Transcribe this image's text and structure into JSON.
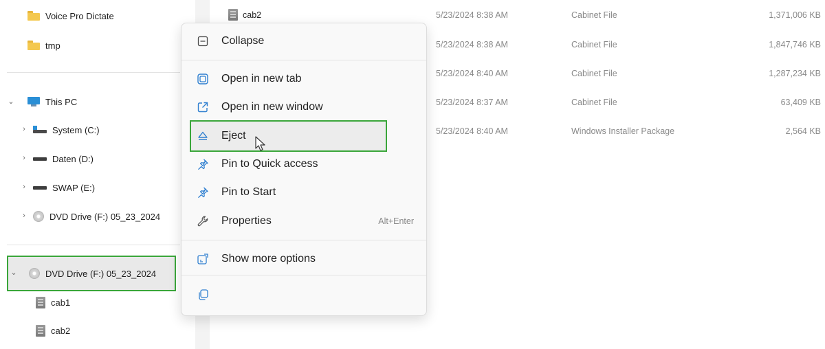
{
  "nav": {
    "items": [
      {
        "label": "Voice Pro Dictate",
        "icon": "folder-icon"
      },
      {
        "label": "tmp",
        "icon": "folder-icon"
      },
      {
        "label": "This PC",
        "icon": "computer-icon",
        "chevron": "expanded"
      },
      {
        "label": "System (C:)",
        "icon": "system-drive-icon",
        "chevron": "collapsed"
      },
      {
        "label": "Daten (D:)",
        "icon": "hard-drive-icon",
        "chevron": "collapsed"
      },
      {
        "label": "SWAP (E:)",
        "icon": "hard-drive-icon",
        "chevron": "collapsed"
      },
      {
        "label": "DVD Drive (F:) 05_23_2024",
        "icon": "dvd-drive-icon",
        "chevron": "collapsed"
      },
      {
        "label": "DVD Drive (F:) 05_23_2024",
        "icon": "dvd-drive-icon",
        "chevron": "expanded",
        "selected": true
      },
      {
        "label": "cab1",
        "icon": "cabinet-file-icon"
      },
      {
        "label": "cab2",
        "icon": "cabinet-file-icon"
      }
    ]
  },
  "files": [
    {
      "name": "cab2",
      "date": "5/23/2024 8:38 AM",
      "type": "Cabinet File",
      "size": "1,371,006 KB"
    },
    {
      "name": "",
      "date": "5/23/2024 8:38 AM",
      "type": "Cabinet File",
      "size": "1,847,746 KB"
    },
    {
      "name": "",
      "date": "5/23/2024 8:40 AM",
      "type": "Cabinet File",
      "size": "1,287,234 KB"
    },
    {
      "name": "",
      "date": "5/23/2024 8:37 AM",
      "type": "Cabinet File",
      "size": "63,409 KB"
    },
    {
      "name": "",
      "date": "5/23/2024 8:40 AM",
      "type": "Windows Installer Package",
      "size": "2,564 KB"
    }
  ],
  "menu": {
    "collapse": "Collapse",
    "open_new_tab": "Open in new tab",
    "open_new_window": "Open in new window",
    "eject": "Eject",
    "pin_quick_access": "Pin to Quick access",
    "pin_start": "Pin to Start",
    "properties": "Properties",
    "properties_shortcut": "Alt+Enter",
    "show_more": "Show more options"
  },
  "colors": {
    "highlight_border": "#3aa63a",
    "menu_icon": "#2f7fd0"
  }
}
